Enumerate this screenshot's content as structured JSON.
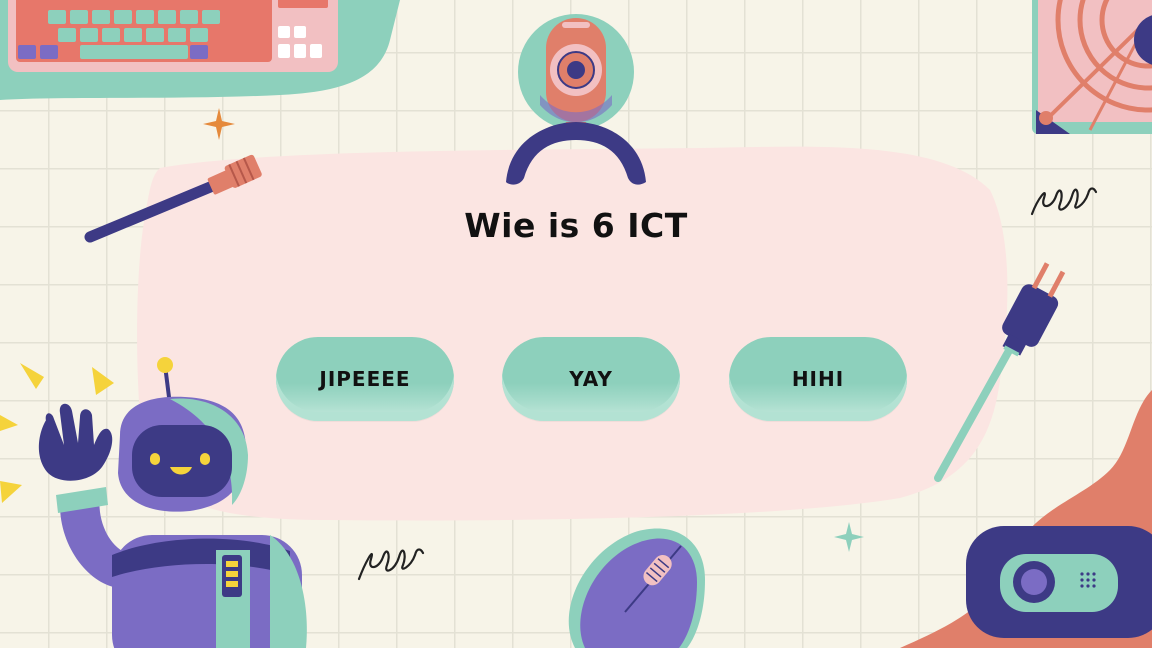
{
  "quiz": {
    "question": "Wie is 6 ICT",
    "options": [
      "JIPEEEE",
      "YAY",
      "HIHI"
    ]
  },
  "colors": {
    "background": "#f7f4e8",
    "panel": "#fbe5e2",
    "button": "#8dd0bc",
    "accent_purple": "#7b6cc4",
    "accent_navy": "#3d3a85",
    "accent_coral": "#e07f6a"
  },
  "icons": [
    "keyboard-icon",
    "webcam-icon",
    "robot-icon",
    "mouse-icon",
    "cable-icon",
    "plug-icon",
    "fan-icon",
    "camera-icon",
    "sparkle-icon",
    "squiggle-icon"
  ]
}
